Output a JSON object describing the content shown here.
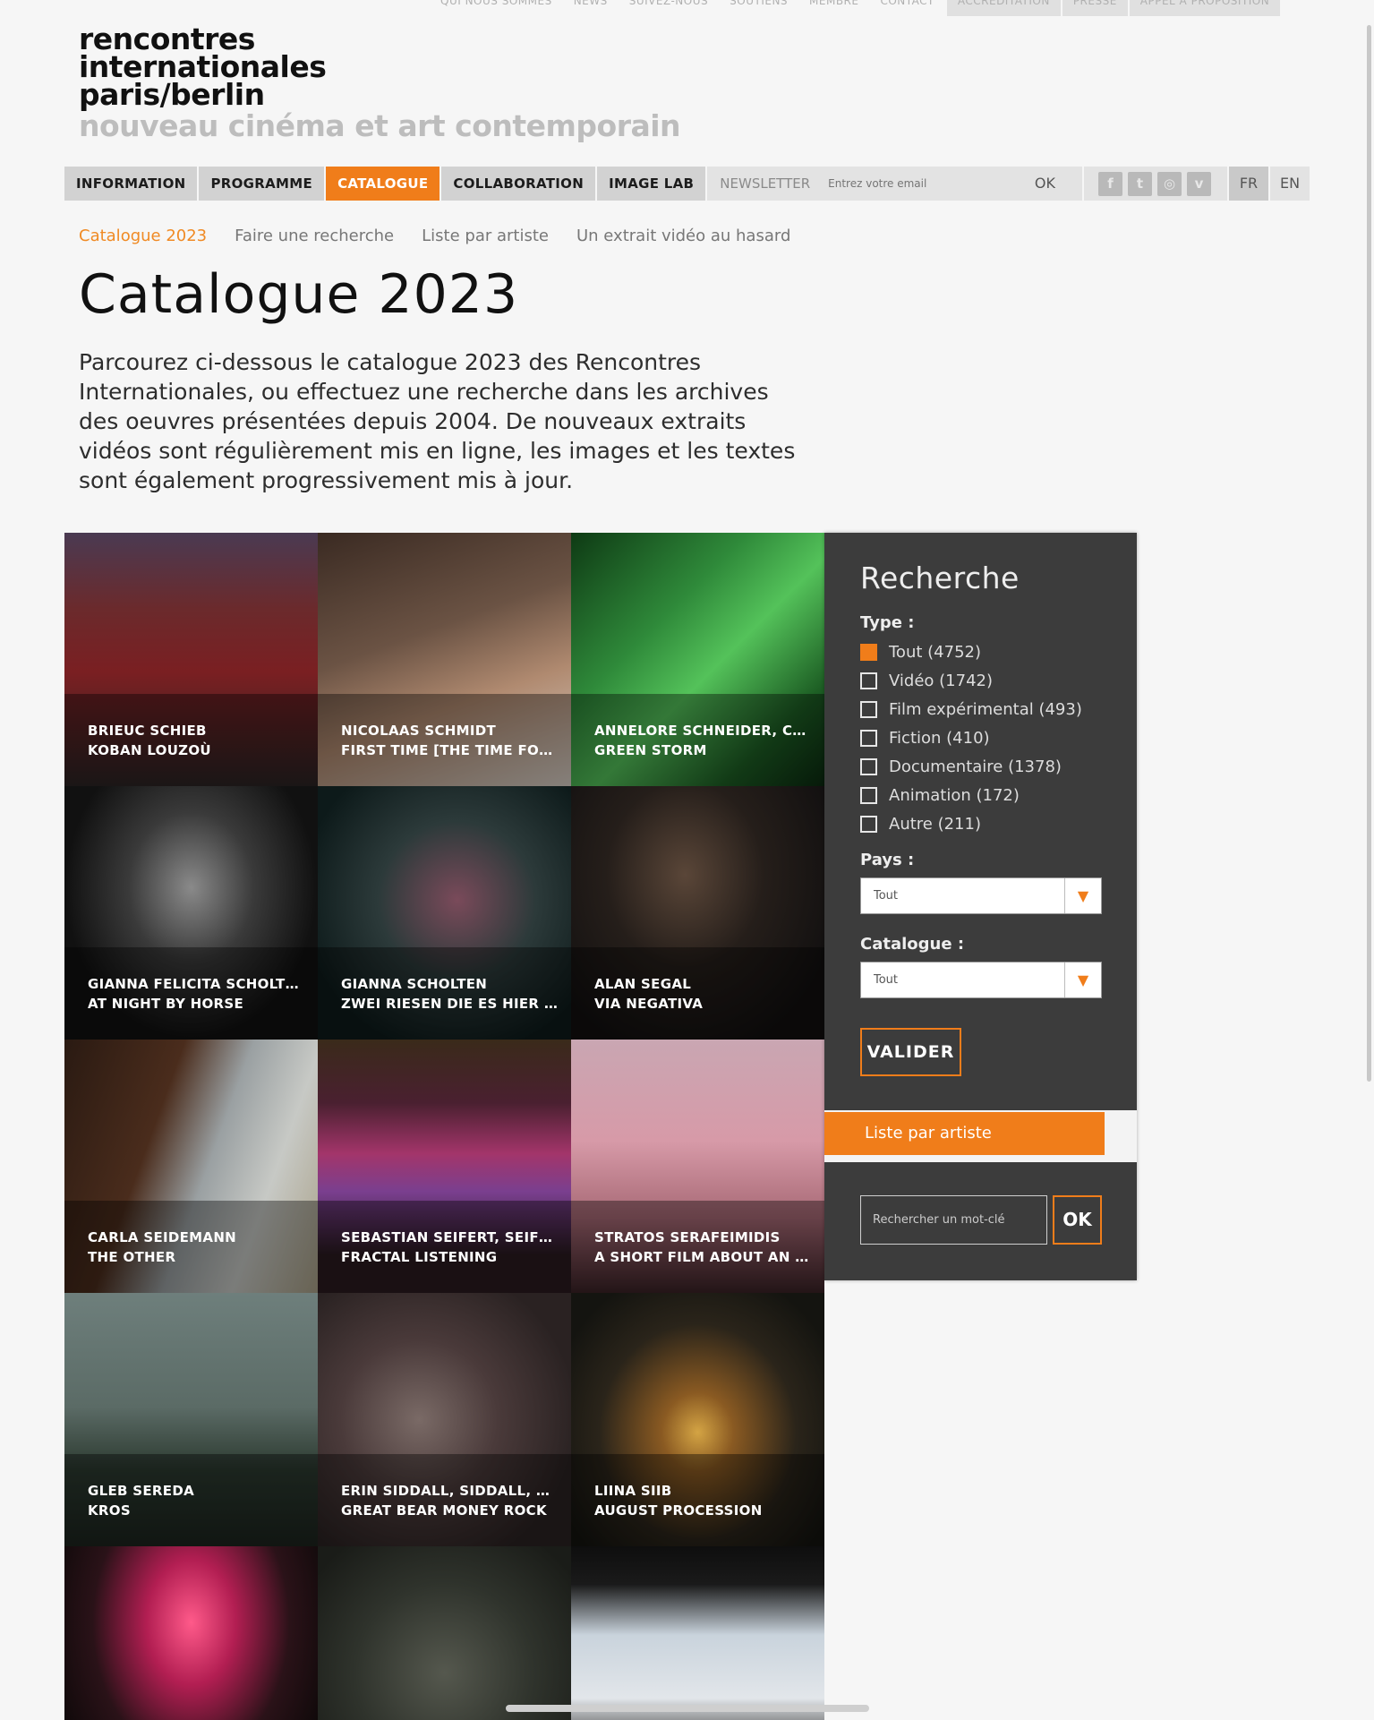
{
  "top_nav": [
    "QUI NOUS SOMMES",
    "NEWS",
    "SUIVEZ-NOUS",
    "SOUTIENS",
    "MEMBRE",
    "CONTACT",
    "ACCRÉDITATION",
    "PRESSE",
    "APPEL À PROPOSITION"
  ],
  "logo": {
    "line1": "rencontres",
    "line2": "internationales",
    "line3": "paris/berlin",
    "tagline": "nouveau cinéma et art contemporain"
  },
  "main_nav": {
    "items": [
      "INFORMATION",
      "PROGRAMME",
      "CATALOGUE",
      "COLLABORATION",
      "IMAGE LAB"
    ],
    "active": "CATALOGUE",
    "newsletter_label": "NEWSLETTER",
    "email_placeholder": "Entrez votre email",
    "ok_label": "OK",
    "socials": [
      {
        "icon": "facebook-icon",
        "glyph": "f"
      },
      {
        "icon": "twitter-icon",
        "glyph": "t"
      },
      {
        "icon": "instagram-icon",
        "glyph": "◎"
      },
      {
        "icon": "vimeo-icon",
        "glyph": "v"
      }
    ],
    "languages": [
      "FR",
      "EN"
    ],
    "active_language": "FR"
  },
  "sub_nav": {
    "items": [
      "Catalogue 2023",
      "Faire une recherche",
      "Liste par artiste",
      "Un extrait vidéo au hasard"
    ],
    "active": "Catalogue 2023"
  },
  "page": {
    "title": "Catalogue 2023",
    "intro": "Parcourez ci-dessous le catalogue 2023 des Rencontres Internationales, ou effectuez une recherche dans les archives des oeuvres présentées depuis 2004. De nouveaux extraits vidéos sont régulièrement mis en ligne, les images et les textes sont également progressivement mis à jour."
  },
  "tiles": [
    {
      "artist": "BRIEUC SCHIEB",
      "title": "KOBAN LOUZOÙ",
      "bg": "linear-gradient(180deg,#4a3a52 0%,#6b2a2c 30%,#7a1f22 55%,#2c2424 100%)"
    },
    {
      "artist": "NICOLAAS SCHMIDT",
      "title": "FIRST TIME [THE TIME FOR ALL BUT SUNSET - VIOLET]",
      "bg": "linear-gradient(160deg,#3a2a22 0%,#6b5344 40%,#b08a70 65%,#d8cfc6 100%)"
    },
    {
      "artist": "ANNELORE SCHNEIDER, CLÉMENT",
      "title": "GREEN STORM",
      "bg": "linear-gradient(135deg,#0e3a14 0%,#2f8a3a 35%,#54c25a 55%,#1d5e24 80%,#0b2a10 100%)"
    },
    {
      "artist": "GIANNA FELICITA SCHOLTEN",
      "title": "AT NIGHT BY HORSE",
      "bg": "radial-gradient(ellipse at 50% 40%,#8a8a8a 0%,#3a3a3a 35%,#111 70%)"
    },
    {
      "artist": "GIANNA SCHOLTEN",
      "title": "ZWEI RIESEN DIE ES HIER GIBT",
      "bg": "radial-gradient(ellipse at 55% 45%,#7a4a5a 0%,#2c3a3a 40%,#0d1a1a 80%)"
    },
    {
      "artist": "ALAN SEGAL",
      "title": "VIA NEGATIVA",
      "bg": "radial-gradient(ellipse at 45% 35%,#5a4638 0%,#251e1a 40%,#121010 80%)"
    },
    {
      "artist": "CARLA SEIDEMANN",
      "title": "THE OTHER",
      "bg": "linear-gradient(110deg,#2a1a12 0%,#4a2c1c 35%,#9aa0a2 55%,#c7c9c5 75%,#a9a087 100%)"
    },
    {
      "artist": "SEBASTIAN SEIFERT, SEIFERT",
      "title": "FRACTAL LISTENING",
      "bg": "linear-gradient(180deg,#3a2a1a 0%,#4a2030 25%,#a3356a 45%,#7a3f8f 60%,#2a1a20 85%)"
    },
    {
      "artist": "STRATOS SERAFEIMIDIS",
      "title": "A SHORT FILM ABOUT AN EGG",
      "bg": "linear-gradient(180deg,#c9a6b2 0%,#d79aa8 40%,#a86a76 70%,#3a2226 100%)"
    },
    {
      "artist": "GLEB SEREDA",
      "title": "KROS",
      "bg": "linear-gradient(180deg,#6e7f7c 0%,#5b6b66 45%,#2c3a30 70%,#1c241e 100%)"
    },
    {
      "artist": "ERIN SIDDALL, SIDDALL, ERIN",
      "title": "GREAT BEAR MONEY ROCK",
      "bg": "radial-gradient(circle at 40% 50%,#7a6a66 0%,#4a3a3a 40%,#2a2222 80%)"
    },
    {
      "artist": "LIINA SIIB",
      "title": "AUGUST PROCESSION",
      "bg": "radial-gradient(ellipse at 50% 55%,#d4a444 0%,#8a5a22 20%,#2a241a 55%,#141410 85%)"
    },
    {
      "artist": "",
      "title": "",
      "bg": "radial-gradient(ellipse at 50% 30%,#ff5a8a 0%,#b21e52 25%,#2a1218 55%,#0c0808 85%)"
    },
    {
      "artist": "",
      "title": "",
      "bg": "radial-gradient(circle at 50% 50%,#55584e 0%,#2f332c 50%,#1a1c18 90%)"
    },
    {
      "artist": "",
      "title": "",
      "bg": "linear-gradient(180deg,#0e0e0e 0%,#1a1a1a 15%,#c9d3dc 35%,#e2e6ea 60%,#2a2a2a 80%,#0c0c0c 100%)"
    }
  ],
  "search": {
    "title": "Recherche",
    "type_label": "Type :",
    "types": [
      {
        "label": "Tout (4752)",
        "checked": true
      },
      {
        "label": "Vidéo (1742)",
        "checked": false
      },
      {
        "label": "Film expérimental (493)",
        "checked": false
      },
      {
        "label": "Fiction (410)",
        "checked": false
      },
      {
        "label": "Documentaire (1378)",
        "checked": false
      },
      {
        "label": "Animation (172)",
        "checked": false
      },
      {
        "label": "Autre (211)",
        "checked": false
      }
    ],
    "pays_label": "Pays :",
    "pays_value": "Tout",
    "catalogue_label": "Catalogue :",
    "catalogue_value": "Tout",
    "submit_label": "VALIDER",
    "artist_list_label": "Liste par artiste",
    "keyword_placeholder": "Rechercher un mot-clé",
    "keyword_ok": "OK"
  }
}
